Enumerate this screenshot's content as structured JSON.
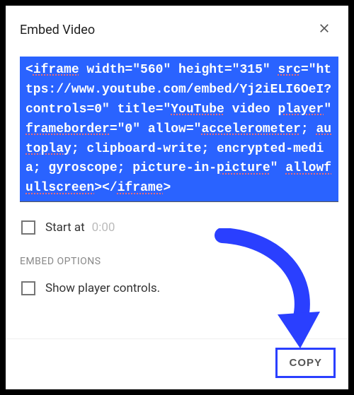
{
  "header": {
    "title": "Embed Video"
  },
  "embed": {
    "code": "<iframe width=\"560\" height=\"315\" src=\"https://www.youtube.com/embed/Yj2iELI6OeI?controls=0\" title=\"YouTube video player\" frameborder=\"0\" allow=\"accelerometer; autoplay; clipboard-write; encrypted-media; gyroscope; picture-in-picture\" allowfullscreen></iframe>",
    "tokens": [
      {
        "t": "<"
      },
      {
        "t": "iframe",
        "u": 1
      },
      {
        "t": " width=\"560\" height=\"315\" "
      },
      {
        "t": "src",
        "u": 1
      },
      {
        "t": "=\"https://www.youtube.com/embed/"
      },
      {
        "t": "Yj2iELI6OeI?controls=0\""
      },
      {
        "t": " title=\""
      },
      {
        "t": "YouTube",
        "u": 1
      },
      {
        "t": " video "
      },
      {
        "t": "player",
        "u": 1
      },
      {
        "t": "\" "
      },
      {
        "t": "frameborder",
        "u": 1
      },
      {
        "t": "=\"0\" allow=\""
      },
      {
        "t": "accelerometer",
        "u": 1
      },
      {
        "t": "; "
      },
      {
        "t": "autoplay",
        "u": 1
      },
      {
        "t": "; clipboard-write; encrypted-media; gyroscope; picture-in-"
      },
      {
        "t": "picture",
        "u": 1
      },
      {
        "t": "\" "
      },
      {
        "t": "allowfullscreen",
        "u": 1
      },
      {
        "t": "></"
      },
      {
        "t": "iframe",
        "u": 1
      },
      {
        "t": ">"
      }
    ]
  },
  "start": {
    "label": "Start at",
    "time": "0:00",
    "checked": false
  },
  "options": {
    "section_label": "EMBED OPTIONS",
    "show_controls": {
      "label": "Show player controls.",
      "checked": false
    }
  },
  "footer": {
    "copy_label": "COPY"
  }
}
